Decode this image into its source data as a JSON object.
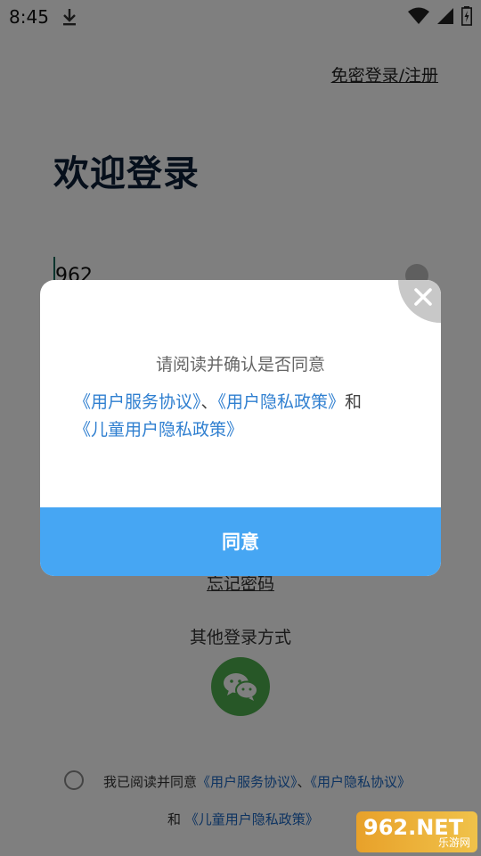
{
  "status": {
    "time": "8:45"
  },
  "page": {
    "top_link": "免密登录/注册",
    "welcome": "欢迎登录",
    "phone_value": "962",
    "forgot": "忘记密码",
    "other_login": "其他登录方式",
    "agree_prefix": "我已阅读并同意",
    "agree_link1": "《用户服务协议》",
    "agree_sep": "、",
    "agree_link2": "《用户隐私协议》",
    "agree_and": "和",
    "agree_link3": "《儿童用户隐私政策》"
  },
  "watermark": {
    "main": "962.NET",
    "sub": "乐游网"
  },
  "dialog": {
    "title": "请阅读并确认是否同意",
    "link1": "《用户服务协议》",
    "sep": "、",
    "link2": "《用户隐私政策》",
    "and": "和",
    "link3": "《儿童用户隐私政策》",
    "agree_button": "同意"
  },
  "colors": {
    "accent": "#46a6f3",
    "link": "#2f7fd0",
    "wechat": "#4eae4e"
  }
}
